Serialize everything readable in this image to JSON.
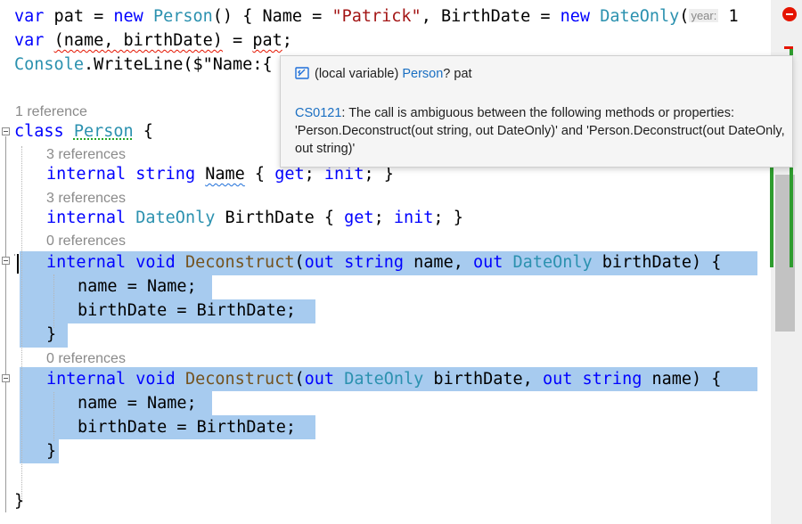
{
  "editor": {
    "lines": {
      "l1": {
        "kw_var": "var",
        "mid1": " pat = ",
        "kw_new": "new",
        "type_person": "Person",
        "mid2": "() { Name = ",
        "str_patrick": "\"Patrick\"",
        "mid3": ", BirthDate = ",
        "kw_new2": "new",
        "type_dateonly": "DateOnly",
        "paren": "(",
        "hint_year": "year:",
        "tail": " 1"
      },
      "l2": {
        "kw_var": "var",
        "sp": " ",
        "tuple": "(name, birthDate)",
        "mid": " = ",
        "pat": "pat",
        "semi": ";"
      },
      "l3": {
        "type_console": "Console",
        "rest": ".WriteLine($\"Name:{"
      },
      "lens_class": "1 reference",
      "l4": {
        "kw_class": "class",
        "sp": " ",
        "type_person": "Person",
        "rest": " {"
      },
      "lens_name": "3 references",
      "l5": {
        "kw_internal": "internal",
        "sp1": " ",
        "kw_string": "string",
        "sp2": " ",
        "name": "Name",
        "rest1": " { ",
        "kw_get": "get",
        "semi1": "; ",
        "kw_init": "init",
        "rest2": "; }"
      },
      "lens_birth": "3 references",
      "l6": {
        "kw_internal": "internal",
        "sp1": " ",
        "type_dateonly": "DateOnly",
        "rest1": " BirthDate { ",
        "kw_get": "get",
        "semi1": "; ",
        "kw_init": "init",
        "rest2": "; }"
      },
      "lens_decon1": "0 references",
      "l7": {
        "kw_internal": "internal",
        "sp1": " ",
        "kw_void": "void",
        "sp2": " ",
        "method": "Deconstruct",
        "p1": "(",
        "kw_out1": "out",
        "sp3": " ",
        "kw_string": "string",
        "a1": " name, ",
        "kw_out2": "out",
        "sp4": " ",
        "type_dateonly": "DateOnly",
        "a2": " birthDate) {"
      },
      "l8": "name = Name;",
      "l9": "birthDate = BirthDate;",
      "l10": "}",
      "lens_decon2": "0 references",
      "l11": {
        "kw_internal": "internal",
        "sp1": " ",
        "kw_void": "void",
        "sp2": " ",
        "method": "Deconstruct",
        "p1": "(",
        "kw_out1": "out",
        "sp3": " ",
        "type_dateonly": "DateOnly",
        "a1": " birthDate, ",
        "kw_out2": "out",
        "sp4": " ",
        "kw_string": "string",
        "a2": " name) {"
      },
      "l12": "name = Name;",
      "l13": "birthDate = BirthDate;",
      "l14": "}",
      "l15": "}"
    }
  },
  "tooltip": {
    "icon": "local-variable-icon",
    "prefix": "(local variable) ",
    "type": "Person",
    "suffix": "? pat",
    "error_code": "CS0121",
    "error_text": ": The call is ambiguous between the following methods or properties: 'Person.Deconstruct(out string, out DateOnly)' and 'Person.Deconstruct(out DateOnly, out string)'"
  },
  "colors": {
    "keyword": "#0000ff",
    "type": "#2b91af",
    "string": "#a31515",
    "selection": "#a7cbef",
    "error": "#e51400",
    "link": "#1a6fc2"
  }
}
